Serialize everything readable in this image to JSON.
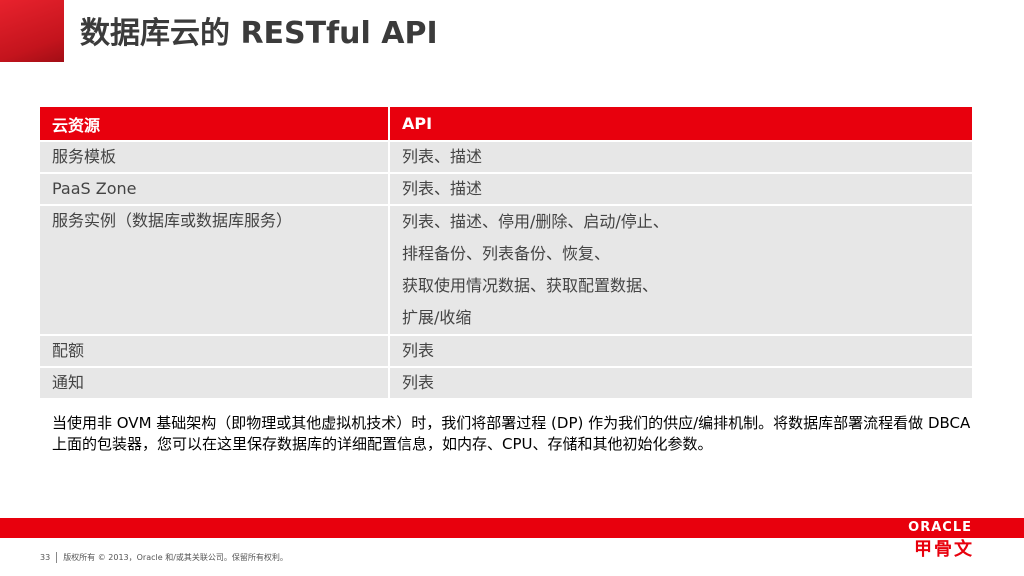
{
  "slide": {
    "title": "数据库云的 RESTful API"
  },
  "table": {
    "headers": [
      "云资源",
      "API"
    ],
    "rows": [
      {
        "resource": "服务模板",
        "api": [
          "列表、描述"
        ]
      },
      {
        "resource": "PaaS Zone",
        "api": [
          "列表、描述"
        ]
      },
      {
        "resource": "服务实例（数据库或数据库服务）",
        "api": [
          "列表、描述、停用/删除、启动/停止、",
          "排程备份、列表备份、恢复、",
          "获取使用情况数据、获取配置数据、",
          "扩展/收缩"
        ]
      },
      {
        "resource": "配额",
        "api": [
          "列表"
        ]
      },
      {
        "resource": "通知",
        "api": [
          "列表"
        ]
      }
    ]
  },
  "note": "当使用非 OVM 基础架构（即物理或其他虚拟机技术）时，我们将部署过程 (DP) 作为我们的供应/编排机制。将数据库部署流程看做 DBCA 上面的包装器，您可以在这里保存数据库的详细配置信息，如内存、CPU、存储和其他初始化参数。",
  "footer": {
    "page_number": "33",
    "copyright": "版权所有 © 2013，Oracle 和/或其关联公司。保留所有权利。"
  },
  "logo": {
    "en": "ORACLE",
    "cn": "甲骨文"
  },
  "colors": {
    "brand_red": "#e8000d",
    "cell_gray": "#e7e7e7"
  }
}
